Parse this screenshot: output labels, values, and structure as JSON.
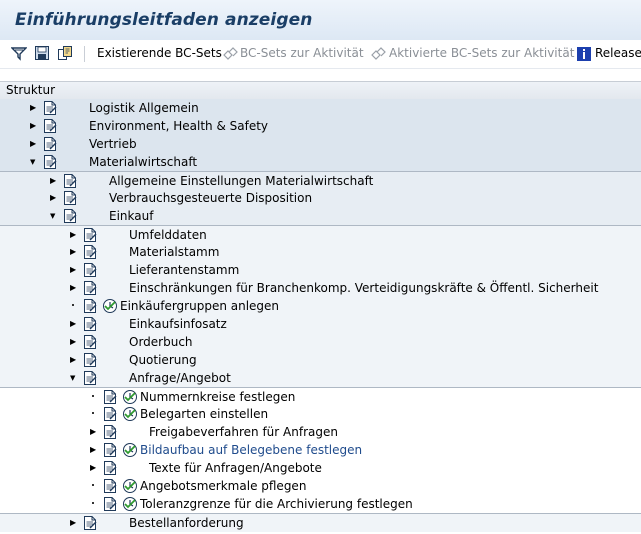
{
  "window": {
    "title": "Einführungsleitfaden anzeigen"
  },
  "toolbar": {
    "icons": [
      "filter-icon",
      "save-icon",
      "copy-structure-icon"
    ],
    "buttons": [
      {
        "label": "Existierende BC-Sets",
        "enabled": true
      },
      {
        "label": "BC-Sets zur Aktivität",
        "enabled": false
      },
      {
        "label": "Aktivierte BC-Sets zur Aktivität",
        "enabled": false
      },
      {
        "label": "Release-",
        "enabled": true,
        "icon": "info-icon"
      }
    ]
  },
  "tree": {
    "header": "Struktur",
    "rows": [
      {
        "level": 0,
        "toggle": "collapsed",
        "label": "Logistik Allgemein",
        "executable": false,
        "link": false
      },
      {
        "level": 0,
        "toggle": "collapsed",
        "label": "Environment, Health & Safety",
        "executable": false,
        "link": false
      },
      {
        "level": 0,
        "toggle": "collapsed",
        "label": "Vertrieb",
        "executable": false,
        "link": false
      },
      {
        "level": 0,
        "toggle": "expanded",
        "label": "Materialwirtschaft",
        "executable": false,
        "link": false
      },
      {
        "level": 1,
        "toggle": "collapsed",
        "label": "Allgemeine Einstellungen Materialwirtschaft",
        "executable": false,
        "link": false
      },
      {
        "level": 1,
        "toggle": "collapsed",
        "label": "Verbrauchsgesteuerte Disposition",
        "executable": false,
        "link": false
      },
      {
        "level": 1,
        "toggle": "expanded",
        "label": "Einkauf",
        "executable": false,
        "link": false
      },
      {
        "level": 2,
        "toggle": "collapsed",
        "label": "Umfelddaten",
        "executable": false,
        "link": false
      },
      {
        "level": 2,
        "toggle": "collapsed",
        "label": "Materialstamm",
        "executable": false,
        "link": false
      },
      {
        "level": 2,
        "toggle": "collapsed",
        "label": "Lieferantenstamm",
        "executable": false,
        "link": false
      },
      {
        "level": 2,
        "toggle": "collapsed",
        "label": "Einschränkungen für Branchenkomp. Verteidigungskräfte & Öffentl. Sicherheit",
        "executable": false,
        "link": false
      },
      {
        "level": 2,
        "toggle": "leaf",
        "label": "Einkäufergruppen anlegen",
        "executable": true,
        "link": false
      },
      {
        "level": 2,
        "toggle": "collapsed",
        "label": "Einkaufsinfosatz",
        "executable": false,
        "link": false
      },
      {
        "level": 2,
        "toggle": "collapsed",
        "label": "Orderbuch",
        "executable": false,
        "link": false
      },
      {
        "level": 2,
        "toggle": "collapsed",
        "label": "Quotierung",
        "executable": false,
        "link": false
      },
      {
        "level": 2,
        "toggle": "expanded",
        "label": "Anfrage/Angebot",
        "executable": false,
        "link": false
      },
      {
        "level": 3,
        "toggle": "leaf",
        "label": "Nummernkreise festlegen",
        "executable": true,
        "link": false
      },
      {
        "level": 3,
        "toggle": "leaf",
        "label": "Belegarten einstellen",
        "executable": true,
        "link": false
      },
      {
        "level": 3,
        "toggle": "collapsed",
        "label": "Freigabeverfahren für Anfragen",
        "executable": false,
        "link": false
      },
      {
        "level": 3,
        "toggle": "collapsed",
        "label": "Bildaufbau auf Belegebene festlegen",
        "executable": true,
        "link": true
      },
      {
        "level": 3,
        "toggle": "collapsed",
        "label": "Texte für Anfragen/Angebote",
        "executable": false,
        "link": false
      },
      {
        "level": 3,
        "toggle": "leaf",
        "label": "Angebotsmerkmale pflegen",
        "executable": true,
        "link": false
      },
      {
        "level": 3,
        "toggle": "leaf",
        "label": "Toleranzgrenze für die Archivierung festlegen",
        "executable": true,
        "link": false
      },
      {
        "level": 2,
        "toggle": "collapsed",
        "label": "Bestellanforderung",
        "executable": false,
        "link": false
      }
    ]
  }
}
